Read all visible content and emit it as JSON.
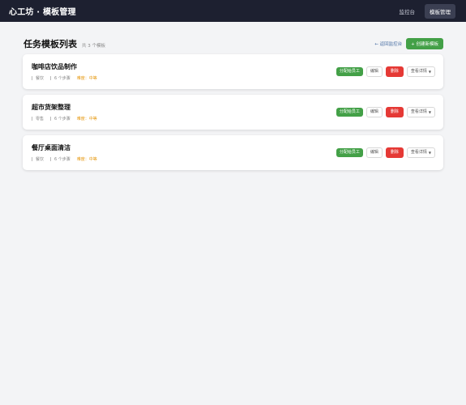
{
  "app": {
    "brand": "心工坊 · 模板管理",
    "nav": [
      {
        "label": "监控台"
      },
      {
        "label": "模板管理"
      }
    ]
  },
  "header": {
    "title": "任务模板列表",
    "count": "共 3 个模板",
    "back_label": "← 返回监控台",
    "create_label": "+ 创建新模板"
  },
  "templates": [
    {
      "title": "咖啡店饮品制作",
      "category": "餐饮",
      "steps": "6 个步骤",
      "difficulty": "难度：中等"
    },
    {
      "title": "超市货架整理",
      "category": "零售",
      "steps": "6 个步骤",
      "difficulty": "难度：中等"
    },
    {
      "title": "餐厅桌面清洁",
      "category": "餐饮",
      "steps": "6 个步骤",
      "difficulty": "难度：中等"
    }
  ],
  "actions": {
    "assign": "分配给员工",
    "edit": "编辑",
    "delete": "删除",
    "detail": "查看详情",
    "detail_caret": "▼"
  },
  "colors": {
    "topbar": "#1d2030",
    "assign": "#43a047",
    "delete": "#e53935",
    "difficulty": "#e6960a"
  }
}
